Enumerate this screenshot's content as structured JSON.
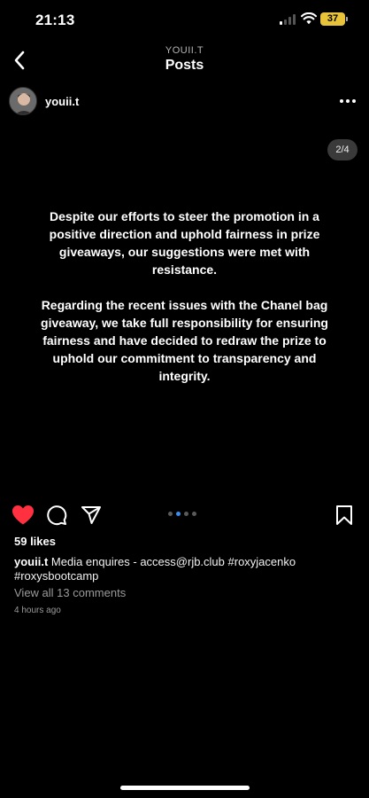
{
  "status_bar": {
    "time": "21:13",
    "battery": "37"
  },
  "header": {
    "subtitle": "YOUII.T",
    "title": "Posts"
  },
  "post": {
    "username": "youii.t",
    "page_counter": "2/4",
    "paragraphs": [
      "Despite our efforts to steer the promotion in a positive direction and uphold fairness in prize giveaways, our suggestions were met with resistance.",
      "Regarding the recent issues with the Chanel bag giveaway, we take full responsibility for ensuring fairness and have decided to redraw the prize to uphold our commitment to transparency and integrity."
    ],
    "carousel": {
      "total": 4,
      "current": 2
    },
    "liked": true,
    "likes_text": "59 likes",
    "caption_user": "youii.t",
    "caption_text": " Media enquires - access@rjb.club #roxyjacenko #roxysbootcamp",
    "comments_link": "View all 13 comments",
    "timestamp": "4 hours ago"
  },
  "icons": {
    "back": "chevron-left-icon",
    "more": "more-horizontal-icon",
    "like": "heart-icon",
    "comment": "comment-icon",
    "share": "send-icon",
    "save": "bookmark-icon"
  },
  "colors": {
    "like": "#ff3040",
    "active_dot": "#3b8cf0",
    "battery": "#e8c33a"
  }
}
